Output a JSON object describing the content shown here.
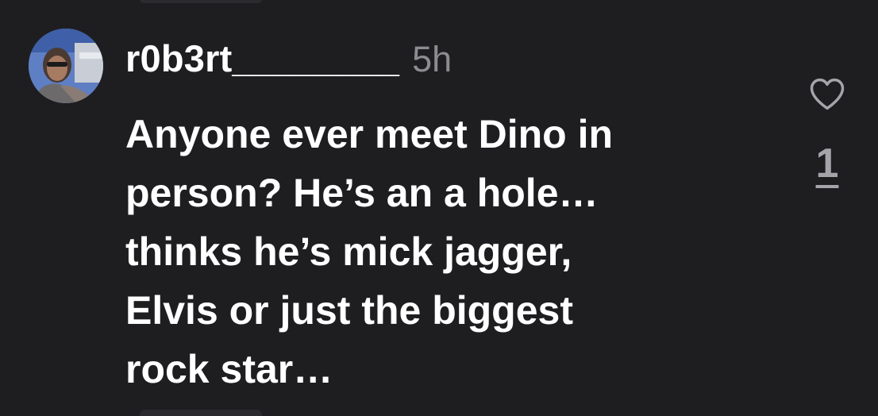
{
  "comment": {
    "username": "r0b3rt________",
    "timestamp": "5h",
    "body_lines": [
      "Anyone ever meet Dino in",
      "person? He’s an a hole…",
      "thinks he’s mick jagger,",
      "Elvis or just the biggest",
      "rock star…"
    ],
    "like_count": "1",
    "like_icon": "heart-outline-icon"
  },
  "colors": {
    "background": "#1e1e21",
    "text": "#ffffff",
    "muted": "#8b8b90",
    "like_count": "#a4a4a9"
  }
}
